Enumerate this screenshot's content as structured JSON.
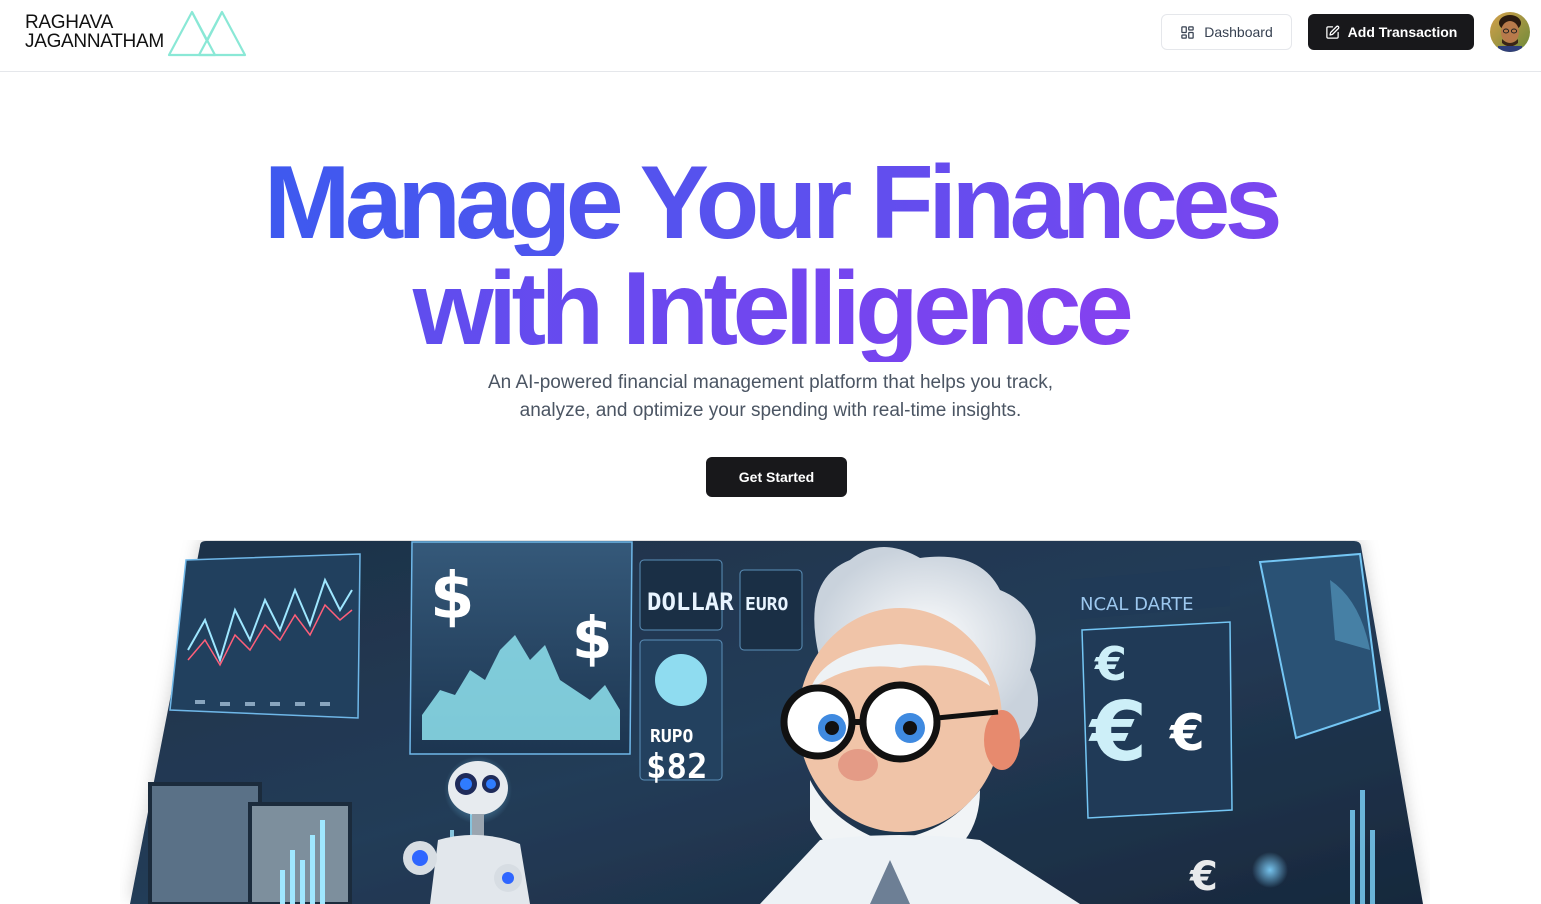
{
  "header": {
    "logo_line1": "RAGHAVA",
    "logo_line2": "JAGANNATHAM",
    "dashboard_label": "Dashboard",
    "add_transaction_label": "Add Transaction"
  },
  "hero": {
    "headline_line1": "Manage Your Finances",
    "headline_line2": "with Intelligence",
    "subtitle_line1": "An AI-powered financial management platform that helps you track,",
    "subtitle_line2": "analyze, and optimize your spending with real-time insights.",
    "cta_label": "Get Started"
  },
  "image": {
    "signs": [
      "DOLLAR",
      "EURO",
      "RUPO",
      "$82",
      "NCAL DARTE",
      "EURO"
    ]
  },
  "colors": {
    "accent_blue": "#2f5ef0",
    "accent_purple": "#9a3cf0",
    "button_dark": "#18181b",
    "logo_mint": "#7fe6d2"
  }
}
